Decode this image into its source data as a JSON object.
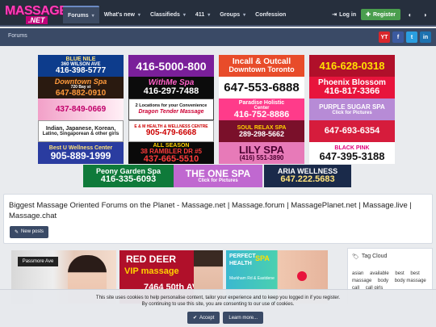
{
  "logo": {
    "line1": "MASSAGE",
    "line2": ".NET"
  },
  "nav": {
    "items": [
      {
        "label": "Forums",
        "active": true,
        "caret": true
      },
      {
        "label": "What's new",
        "active": false,
        "caret": true
      },
      {
        "label": "Classifieds",
        "active": false,
        "caret": true
      },
      {
        "label": "411",
        "active": false,
        "caret": true
      },
      {
        "label": "Groups",
        "active": false,
        "caret": true
      },
      {
        "label": "Confession",
        "active": false,
        "caret": false
      }
    ],
    "login": "Log in",
    "register": "Register"
  },
  "breadcrumb": {
    "label": "Forums"
  },
  "social": [
    "YT",
    "f",
    "t",
    "in"
  ],
  "banners": {
    "b1": [
      "BLUE NILE",
      "360 WILSON AVE",
      "416-398-5777"
    ],
    "b2": [
      "416-5000-800"
    ],
    "b3": [
      "Incall & Outcall",
      "Downtown Toronto"
    ],
    "b4": [
      "416-628-0318"
    ],
    "b5": [
      "Downtown Spa",
      "720 Bay st",
      "647-882-0910"
    ],
    "b6": [
      "WithMe Spa",
      "416-297-7488"
    ],
    "b7": [
      "647-553-6888"
    ],
    "b8": [
      "Phoenix Blossom",
      "416-817-3366"
    ],
    "b9": [
      "437-849-0669"
    ],
    "b10": [
      "2 Locations for your Convenience",
      "Dragon Tender Massage"
    ],
    "b11": [
      "Paradise Holistic",
      "Center",
      "416-752-8886"
    ],
    "b12": [
      "PURPLE SUGAR SPA",
      "Click for Pictures"
    ],
    "b13": [
      "Indian, Japanese, Korean,",
      "Latino, Singaporean & other girls"
    ],
    "b14": [
      "E & M HEALTH & WELLNESS CENTRE",
      "905-479-6668"
    ],
    "b15": [
      "SOUL RELAX SPA",
      "289-298-5662"
    ],
    "b16": [
      "647-693-6354"
    ],
    "b17": [
      "Best U Wellness Center",
      "905-889-1999"
    ],
    "b18": [
      "ALL SEASON",
      "38 RAMBLER DR #5",
      "437-665-5510"
    ],
    "b19": [
      "LILY SPA",
      "(416) 551-3890"
    ],
    "b20": [
      "BLACK PINK",
      "647-395-3188"
    ],
    "b21": [
      "Peony Garden Spa",
      "416-335-6093"
    ],
    "b22": [
      "THE ONE SPA",
      "Click for Pictures"
    ],
    "b23": [
      "ARIA WELLNESS",
      "647.222.5683"
    ]
  },
  "info": {
    "text": "Biggest Massage Oriented Forums on the Planet - Massage.net | Massage.forum | MassagePlanet.net | Massage.live | Massage.chat",
    "new_posts": "New posts"
  },
  "ads": {
    "a1": "Passmore Ave",
    "a2_1": "RED DEER",
    "a2_2": "VIP massage",
    "a2_3": "7464 50th AVE",
    "a3_1": "PERFECT",
    "a3_2": "HEALTH",
    "a3_3": "SPA",
    "a3_4": "Markham Rd & Eastdene"
  },
  "tag_cloud": {
    "title": "Tag Cloud",
    "tags": [
      "asian",
      "available",
      "best",
      "best massage",
      "body",
      "body massage",
      "call",
      "call girls"
    ]
  },
  "cookie": {
    "line1": "This site uses cookies to help personalise content, tailor your experience and to keep you logged in if you register.",
    "line2": "By continuing to use this site, you are consenting to our use of cookies.",
    "accept": "Accept",
    "learn": "Learn more..."
  }
}
